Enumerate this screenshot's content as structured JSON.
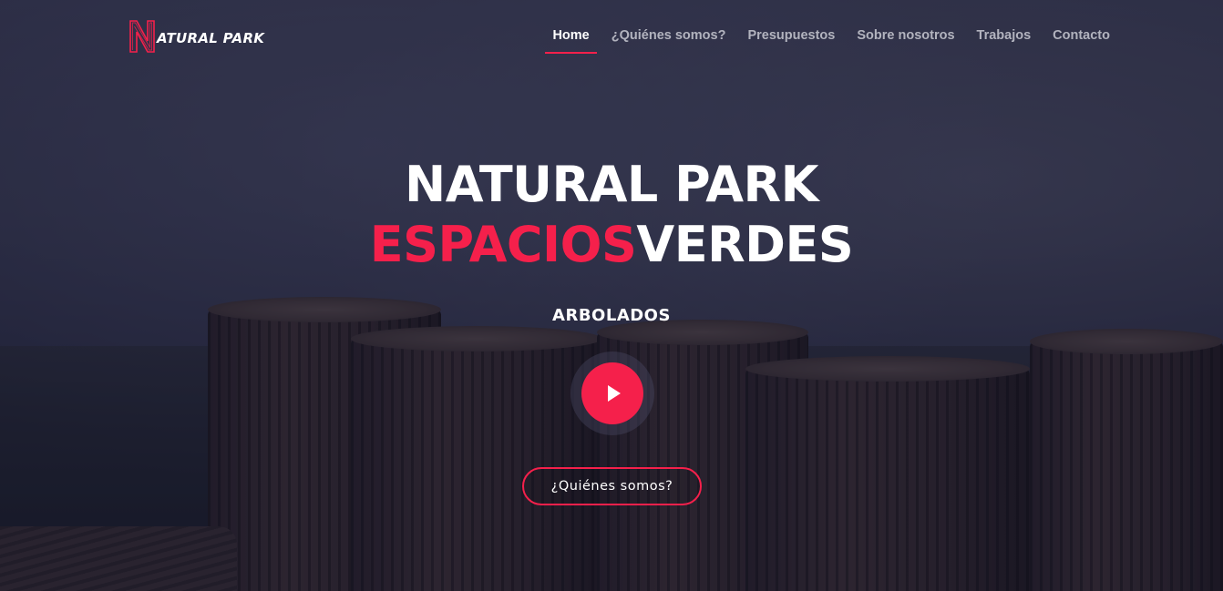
{
  "brand": {
    "logo_text": "ATURAL PARK",
    "logo_letter": "N",
    "accent_color": "#f5204b"
  },
  "nav": {
    "items": [
      {
        "label": "Home",
        "active": true
      },
      {
        "label": "¿Quiénes somos?",
        "active": false
      },
      {
        "label": "Presupuestos",
        "active": false
      },
      {
        "label": "Sobre nosotros",
        "active": false
      },
      {
        "label": "Trabajos",
        "active": false
      },
      {
        "label": "Contacto",
        "active": false
      }
    ]
  },
  "hero": {
    "title_line1": "NATURAL PARK",
    "title_line2_accent": "ESPACIOS",
    "title_line2_rest": "VERDES",
    "subtitle": "ARBOLADOS",
    "play_icon": "play-icon",
    "cta_label": "¿Quiénes somos?"
  }
}
